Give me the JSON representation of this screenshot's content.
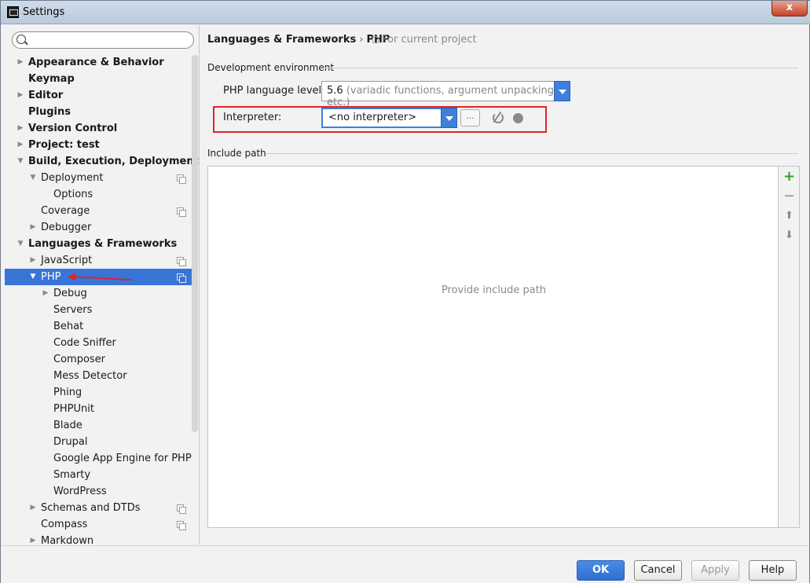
{
  "window": {
    "title": "Settings",
    "close_glyph": "x"
  },
  "search": {
    "value": "",
    "placeholder": ""
  },
  "tree": [
    {
      "label": "Appearance & Behavior",
      "level": 0,
      "arrow": "right",
      "bold": true
    },
    {
      "label": "Keymap",
      "level": 0,
      "arrow": "",
      "bold": true
    },
    {
      "label": "Editor",
      "level": 0,
      "arrow": "right",
      "bold": true
    },
    {
      "label": "Plugins",
      "level": 0,
      "arrow": "",
      "bold": true
    },
    {
      "label": "Version Control",
      "level": 0,
      "arrow": "right",
      "bold": true
    },
    {
      "label": "Project: test",
      "level": 0,
      "arrow": "right",
      "bold": true
    },
    {
      "label": "Build, Execution, Deployment",
      "level": 0,
      "arrow": "down",
      "bold": true
    },
    {
      "label": "Deployment",
      "level": 1,
      "arrow": "down",
      "icon": true
    },
    {
      "label": "Options",
      "level": 2,
      "arrow": ""
    },
    {
      "label": "Coverage",
      "level": 1,
      "arrow": "",
      "icon": true
    },
    {
      "label": "Debugger",
      "level": 1,
      "arrow": "right"
    },
    {
      "label": "Languages & Frameworks",
      "level": 0,
      "arrow": "down",
      "bold": true
    },
    {
      "label": "JavaScript",
      "level": 1,
      "arrow": "right",
      "icon": true
    },
    {
      "label": "PHP",
      "level": 1,
      "arrow": "down",
      "icon": true,
      "selected": true
    },
    {
      "label": "Debug",
      "level": 2,
      "arrow": "right"
    },
    {
      "label": "Servers",
      "level": 2,
      "arrow": ""
    },
    {
      "label": "Behat",
      "level": 2,
      "arrow": ""
    },
    {
      "label": "Code Sniffer",
      "level": 2,
      "arrow": ""
    },
    {
      "label": "Composer",
      "level": 2,
      "arrow": ""
    },
    {
      "label": "Mess Detector",
      "level": 2,
      "arrow": ""
    },
    {
      "label": "Phing",
      "level": 2,
      "arrow": ""
    },
    {
      "label": "PHPUnit",
      "level": 2,
      "arrow": ""
    },
    {
      "label": "Blade",
      "level": 2,
      "arrow": ""
    },
    {
      "label": "Drupal",
      "level": 2,
      "arrow": ""
    },
    {
      "label": "Google App Engine for PHP",
      "level": 2,
      "arrow": ""
    },
    {
      "label": "Smarty",
      "level": 2,
      "arrow": ""
    },
    {
      "label": "WordPress",
      "level": 2,
      "arrow": ""
    },
    {
      "label": "Schemas and DTDs",
      "level": 1,
      "arrow": "right",
      "icon": true
    },
    {
      "label": "Compass",
      "level": 1,
      "arrow": "",
      "icon": true
    },
    {
      "label": "Markdown",
      "level": 1,
      "arrow": "right"
    }
  ],
  "breadcrumb": {
    "parent": "Languages & Frameworks",
    "separator": "›",
    "current": "PHP",
    "note": "For current project"
  },
  "dev_env": {
    "title": "Development environment",
    "lang_label": "PHP language level:",
    "lang_value": "5.6",
    "lang_hint": "(variadic functions, argument unpacking, etc.)",
    "interp_label": "Interpreter:",
    "interp_value": "<no interpreter>",
    "dots_label": "..."
  },
  "include_path": {
    "title": "Include path",
    "empty_text": "Provide include path",
    "tools": {
      "add": "+",
      "remove": "−",
      "up": "⬆",
      "down": "⬇"
    }
  },
  "buttons": {
    "ok": "OK",
    "cancel": "Cancel",
    "apply": "Apply",
    "help": "Help"
  },
  "colors": {
    "selection": "#3875d7",
    "highlight": "#e0242b",
    "add": "#29a329"
  }
}
